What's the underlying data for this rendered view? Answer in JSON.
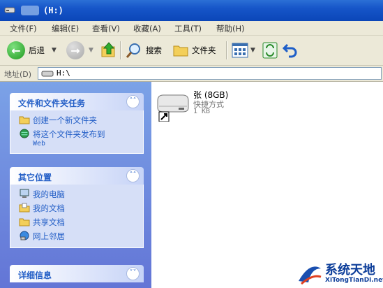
{
  "window": {
    "title": "(H:)"
  },
  "menu": [
    "文件(F)",
    "编辑(E)",
    "查看(V)",
    "收藏(A)",
    "工具(T)",
    "帮助(H)"
  ],
  "toolbar": {
    "back_label": "后退",
    "search_label": "搜索",
    "folders_label": "文件夹"
  },
  "address": {
    "label": "地址(D)",
    "value": "H:\\"
  },
  "sidebar": {
    "tasks": {
      "title": "文件和文件夹任务",
      "items": [
        "创建一个新文件夹",
        "将这个文件夹发布到",
        "Web"
      ]
    },
    "places": {
      "title": "其它位置",
      "items": [
        "我的电脑",
        "我的文档",
        "共享文档",
        "网上邻居"
      ]
    },
    "details": {
      "title": "详细信息"
    }
  },
  "file": {
    "name": "张 (8GB)",
    "type": "快捷方式",
    "size": "1 KB"
  },
  "watermark": {
    "title": "系统天地",
    "url": "XiTongTianDi.net"
  }
}
